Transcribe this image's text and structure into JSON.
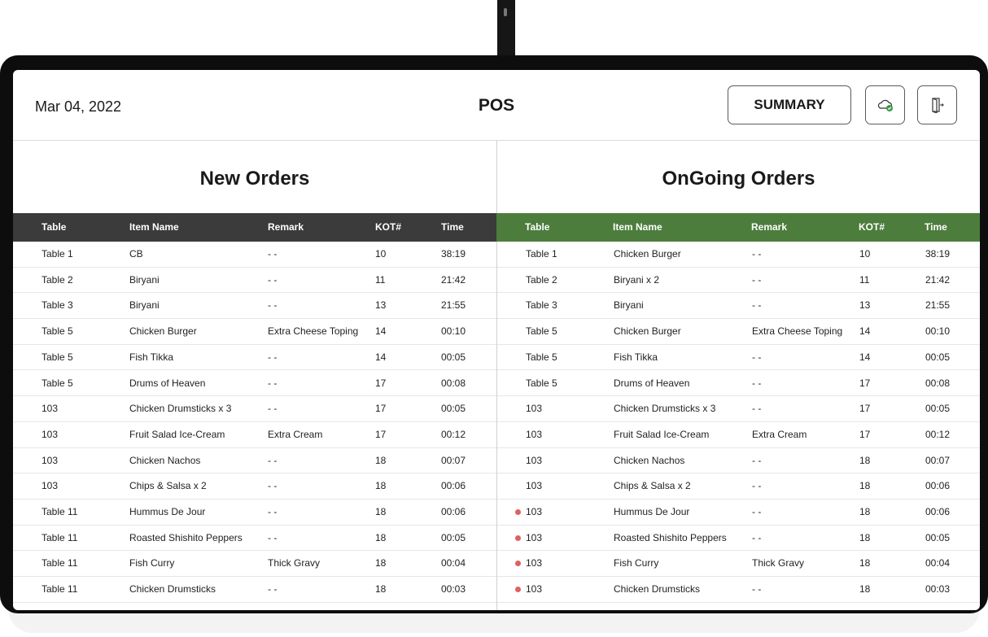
{
  "header": {
    "date": "Mar 04, 2022",
    "title": "POS",
    "summary_label": "SUMMARY",
    "icons": {
      "cloud": "cloud-check-icon",
      "exit": "exit-door-icon"
    }
  },
  "colors": {
    "new_header": "#3b3b3b",
    "ongoing_header": "#4c7d3c",
    "alert_dot": "#e06060"
  },
  "columns": [
    "Table",
    "Item Name",
    "Remark",
    "KOT#",
    "Time"
  ],
  "new_orders": {
    "title": "New Orders",
    "rows": [
      {
        "table": "Table 1",
        "item": "CB",
        "remark": "- -",
        "kot": "10",
        "time": "38:19"
      },
      {
        "table": "Table 2",
        "item": "Biryani",
        "remark": "- -",
        "kot": "11",
        "time": "21:42"
      },
      {
        "table": "Table 3",
        "item": "Biryani",
        "remark": "- -",
        "kot": "13",
        "time": "21:55"
      },
      {
        "table": "Table 5",
        "item": "Chicken Burger",
        "remark": "Extra Cheese Toping",
        "kot": "14",
        "time": "00:10"
      },
      {
        "table": "Table 5",
        "item": "Fish Tikka",
        "remark": "- -",
        "kot": "14",
        "time": "00:05"
      },
      {
        "table": "Table 5",
        "item": "Drums of Heaven",
        "remark": "- -",
        "kot": "17",
        "time": "00:08"
      },
      {
        "table": "103",
        "item": "Chicken Drumsticks x 3",
        "remark": "- -",
        "kot": "17",
        "time": "00:05"
      },
      {
        "table": "103",
        "item": "Fruit Salad Ice-Cream",
        "remark": "Extra Cream",
        "kot": "17",
        "time": "00:12"
      },
      {
        "table": "103",
        "item": "Chicken Nachos",
        "remark": "- -",
        "kot": "18",
        "time": "00:07"
      },
      {
        "table": "103",
        "item": "Chips & Salsa x 2",
        "remark": "- -",
        "kot": "18",
        "time": "00:06"
      },
      {
        "table": "Table 11",
        "item": "Hummus De Jour",
        "remark": "- -",
        "kot": "18",
        "time": "00:06"
      },
      {
        "table": "Table 11",
        "item": "Roasted Shishito Peppers",
        "remark": "- -",
        "kot": "18",
        "time": "00:05"
      },
      {
        "table": "Table 11",
        "item": "Fish Curry",
        "remark": "Thick Gravy",
        "kot": "18",
        "time": "00:04"
      },
      {
        "table": "Table 11",
        "item": "Chicken Drumsticks",
        "remark": "- -",
        "kot": "18",
        "time": "00:03"
      }
    ]
  },
  "ongoing_orders": {
    "title": "OnGoing Orders",
    "rows": [
      {
        "table": "Table 1",
        "item": "Chicken Burger",
        "remark": "- -",
        "kot": "10",
        "time": "38:19",
        "alert": false
      },
      {
        "table": "Table 2",
        "item": "Biryani x 2",
        "remark": "- -",
        "kot": "11",
        "time": "21:42",
        "alert": false
      },
      {
        "table": "Table 3",
        "item": "Biryani",
        "remark": "- -",
        "kot": "13",
        "time": "21:55",
        "alert": false
      },
      {
        "table": "Table 5",
        "item": "Chicken Burger",
        "remark": "Extra Cheese Toping",
        "kot": "14",
        "time": "00:10",
        "alert": false
      },
      {
        "table": "Table 5",
        "item": "Fish Tikka",
        "remark": "- -",
        "kot": "14",
        "time": "00:05",
        "alert": false
      },
      {
        "table": "Table 5",
        "item": "Drums of Heaven",
        "remark": "- -",
        "kot": "17",
        "time": "00:08",
        "alert": false
      },
      {
        "table": "103",
        "item": "Chicken Drumsticks x 3",
        "remark": "- -",
        "kot": "17",
        "time": "00:05",
        "alert": false
      },
      {
        "table": "103",
        "item": "Fruit Salad Ice-Cream",
        "remark": "Extra Cream",
        "kot": "17",
        "time": "00:12",
        "alert": false
      },
      {
        "table": "103",
        "item": "Chicken Nachos",
        "remark": "- -",
        "kot": "18",
        "time": "00:07",
        "alert": false
      },
      {
        "table": "103",
        "item": "Chips & Salsa x 2",
        "remark": "- -",
        "kot": "18",
        "time": "00:06",
        "alert": false
      },
      {
        "table": "103",
        "item": "Hummus De Jour",
        "remark": "- -",
        "kot": "18",
        "time": "00:06",
        "alert": true
      },
      {
        "table": "103",
        "item": "Roasted Shishito Peppers",
        "remark": "- -",
        "kot": "18",
        "time": "00:05",
        "alert": true
      },
      {
        "table": "103",
        "item": "Fish Curry",
        "remark": "Thick Gravy",
        "kot": "18",
        "time": "00:04",
        "alert": true
      },
      {
        "table": "103",
        "item": "Chicken Drumsticks",
        "remark": "- -",
        "kot": "18",
        "time": "00:03",
        "alert": true
      }
    ]
  }
}
